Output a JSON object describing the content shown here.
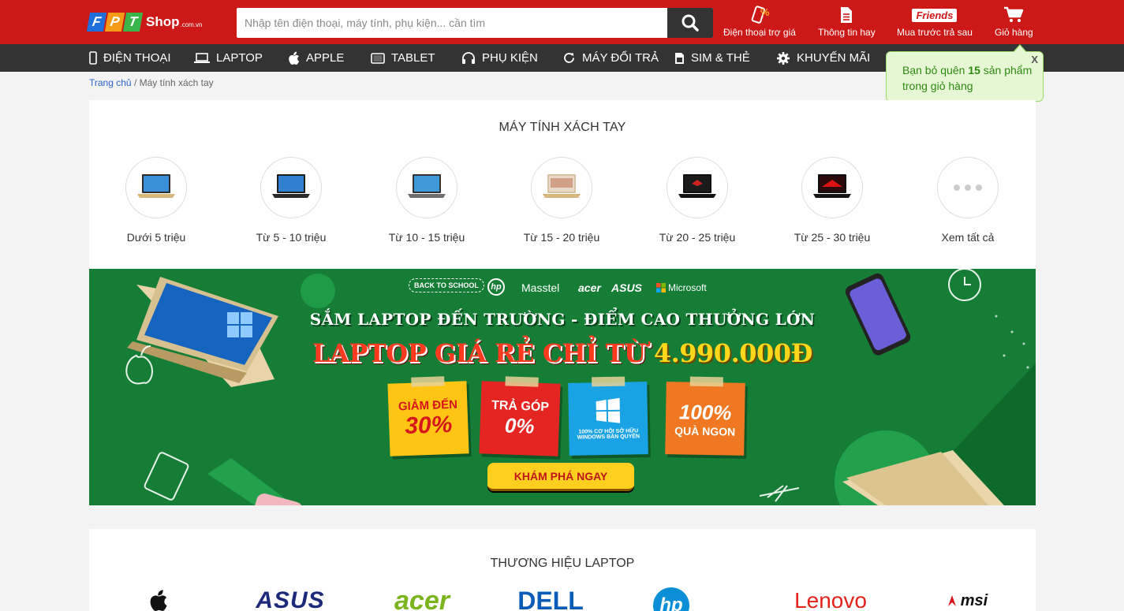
{
  "header": {
    "logo": {
      "letters": [
        "F",
        "P",
        "T"
      ],
      "shop": "Shop",
      "domain": ".com.vn"
    },
    "search": {
      "placeholder": "Nhập tên điện thoại, máy tính, phụ kiện... cần tìm",
      "value": ""
    },
    "links": [
      {
        "label": "Điện thoại trợ giá",
        "icon": "phone-discount-icon"
      },
      {
        "label": "Thông tin hay",
        "icon": "document-icon"
      },
      {
        "label": "Mua trước trả sau",
        "icon": "friends-logo-icon",
        "brand": "Friends"
      },
      {
        "label": "Giỏ hàng",
        "icon": "cart-icon"
      }
    ]
  },
  "nav": [
    {
      "label": "ĐIỆN THOẠI",
      "icon": "phone-icon"
    },
    {
      "label": "LAPTOP",
      "icon": "laptop-icon"
    },
    {
      "label": "APPLE",
      "icon": "apple-icon"
    },
    {
      "label": "TABLET",
      "icon": "tablet-icon"
    },
    {
      "label": "PHỤ KIỆN",
      "icon": "headphones-icon"
    },
    {
      "label": "MÁY ĐỔI TRẢ",
      "icon": "refresh-icon"
    },
    {
      "label": "SIM & THẺ",
      "icon": "sim-icon"
    },
    {
      "label": "KHUYẾN MÃI",
      "icon": "gear-icon"
    }
  ],
  "breadcrumb": {
    "home": "Trang chủ",
    "separator": "/",
    "current": "Máy tính xách tay"
  },
  "cart_tooltip": {
    "close": "X",
    "prefix": "Bạn bỏ quên ",
    "count": "15",
    "suffix_line1": " sản phẩm",
    "line2": "trong giỏ hàng"
  },
  "categories": {
    "title": "MÁY TÍNH XÁCH TAY",
    "items": [
      {
        "label": "Dưới 5 triệu",
        "icon": "laptop-gold-icon"
      },
      {
        "label": "Từ 5 - 10 triệu",
        "icon": "laptop-black-icon"
      },
      {
        "label": "Từ 10 - 15 triệu",
        "icon": "laptop-gray-icon"
      },
      {
        "label": "Từ 15 - 20 triệu",
        "icon": "laptop-silver-icon"
      },
      {
        "label": "Từ 20 - 25 triệu",
        "icon": "laptop-gaming-icon"
      },
      {
        "label": "Từ 25 - 30 triệu",
        "icon": "laptop-msi-icon"
      },
      {
        "label": "Xem tất cả",
        "icon": "more-dots-icon"
      }
    ]
  },
  "banner": {
    "badge": "BACK TO SCHOOL",
    "brands": [
      "hp",
      "Masstel",
      "acer",
      "ASUS",
      "Microsoft"
    ],
    "headline": "SẮM LAPTOP ĐẾN TRƯỜNG - ĐIỂM CAO THƯỞNG LỚN",
    "subline_prefix": "LAPTOP GIÁ RẺ CHỈ TỪ ",
    "subline_price": "4.990.000Đ",
    "notes": [
      {
        "line1": "GIẢM ĐẾN",
        "line2": "30%",
        "color": "#ffc515",
        "text_color": "#d6161a"
      },
      {
        "line1": "TRẢ GÓP",
        "line2": "0%",
        "color": "#e52521",
        "text_color": "#ffffff"
      },
      {
        "line1": "100% CƠ HỘI SỞ HỮU",
        "line2": "WINDOWS BẢN QUYỀN",
        "color": "#1aa3e4",
        "text_color": "#ffffff"
      },
      {
        "line1": "100%",
        "line2": "QUÀ NGON",
        "color": "#f07822",
        "text_color": "#ffffff"
      }
    ],
    "cta": "KHÁM PHÁ NGAY"
  },
  "brands": {
    "title": "THƯƠNG HIỆU LAPTOP",
    "items": [
      "apple",
      "ASUS",
      "acer",
      "DELL",
      "hp",
      "Lenovo",
      "msi"
    ]
  },
  "colors": {
    "header_red": "#cd1818",
    "nav_dark": "#333333",
    "banner_green": "#157a35",
    "cta_yellow": "#ffcf1f"
  }
}
